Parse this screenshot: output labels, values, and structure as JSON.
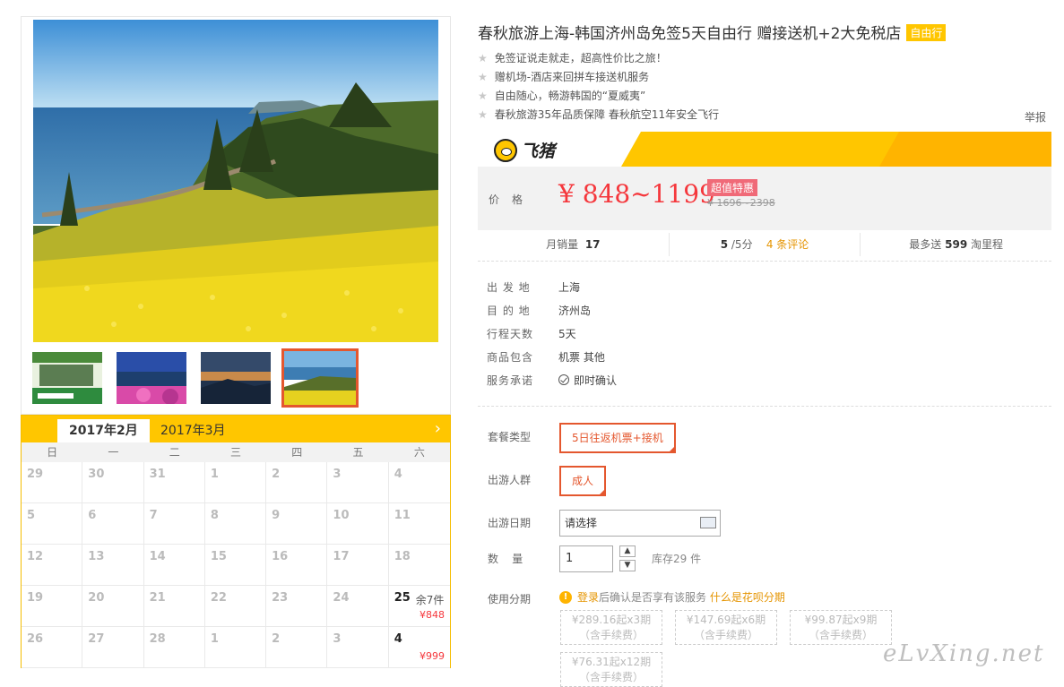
{
  "product": {
    "title": "春秋旅游上海-韩国济州岛免签5天自由行 赠接送机+2大免税店",
    "tag": "自由行",
    "features": [
      "免签证说走就走，超高性价比之旅！",
      "赠机场-酒店来回拼车接送机服务",
      "自由随心，畅游韩国的“夏威夷”",
      "春秋旅游35年品质保障 春秋航空11年安全飞行"
    ],
    "report": "举报"
  },
  "brand": {
    "name": "飞猪"
  },
  "price": {
    "label": "价格",
    "value": "¥ 848~1199",
    "promo_tag": "超值特惠",
    "original": "¥ 1696~2398"
  },
  "stats": {
    "monthly_sales_label": "月销量",
    "monthly_sales": "17",
    "rating": "5",
    "rating_suffix": "/5分",
    "reviews": "4 条评论",
    "points_prefix": "最多送",
    "points": "599",
    "points_suffix": "淘里程"
  },
  "info": [
    {
      "key": "出 发 地",
      "value": "上海"
    },
    {
      "key": "目 的 地",
      "value": "济州岛"
    },
    {
      "key": "行程天数",
      "value": "5天"
    },
    {
      "key": "商品包含",
      "value": "机票  其他"
    },
    {
      "key": "服务承诺",
      "value": "即时确认"
    }
  ],
  "options": {
    "package_label": "套餐类型",
    "package_value": "5日往返机票+接机",
    "traveler_label": "出游人群",
    "traveler_value": "成人",
    "date_label": "出游日期",
    "date_placeholder": "请选择",
    "qty_label": "数    量",
    "qty_value": "1",
    "stock": "库存29 件",
    "installment_label": "使用分期",
    "installment_login": "登录",
    "installment_note": "后确认是否享有该服务",
    "installment_link": "什么是花呗分期"
  },
  "installments": [
    {
      "line1": "¥289.16起x3期",
      "line2": "（含手续费）"
    },
    {
      "line1": "¥147.69起x6期",
      "line2": "（含手续费）"
    },
    {
      "line1": "¥99.87起x9期",
      "line2": "（含手续费）"
    },
    {
      "line1": "¥76.31起x12期",
      "line2": "（含手续费）"
    }
  ],
  "calendar": {
    "months": [
      "2017年2月",
      "2017年3月"
    ],
    "weekdays": [
      "日",
      "一",
      "二",
      "三",
      "四",
      "五",
      "六"
    ],
    "days": [
      {
        "d": "29"
      },
      {
        "d": "30"
      },
      {
        "d": "31"
      },
      {
        "d": "1"
      },
      {
        "d": "2"
      },
      {
        "d": "3"
      },
      {
        "d": "4"
      },
      {
        "d": "5"
      },
      {
        "d": "6"
      },
      {
        "d": "7"
      },
      {
        "d": "8"
      },
      {
        "d": "9"
      },
      {
        "d": "10"
      },
      {
        "d": "11"
      },
      {
        "d": "12"
      },
      {
        "d": "13"
      },
      {
        "d": "14"
      },
      {
        "d": "15"
      },
      {
        "d": "16"
      },
      {
        "d": "17"
      },
      {
        "d": "18"
      },
      {
        "d": "19"
      },
      {
        "d": "20"
      },
      {
        "d": "21"
      },
      {
        "d": "22"
      },
      {
        "d": "23"
      },
      {
        "d": "24"
      },
      {
        "d": "25",
        "stock": "余7件",
        "price": "¥848"
      },
      {
        "d": "26"
      },
      {
        "d": "27"
      },
      {
        "d": "28"
      },
      {
        "d": "1"
      },
      {
        "d": "2"
      },
      {
        "d": "3"
      },
      {
        "d": "4",
        "price": "¥999"
      }
    ]
  },
  "watermark": "eLvXing.net"
}
